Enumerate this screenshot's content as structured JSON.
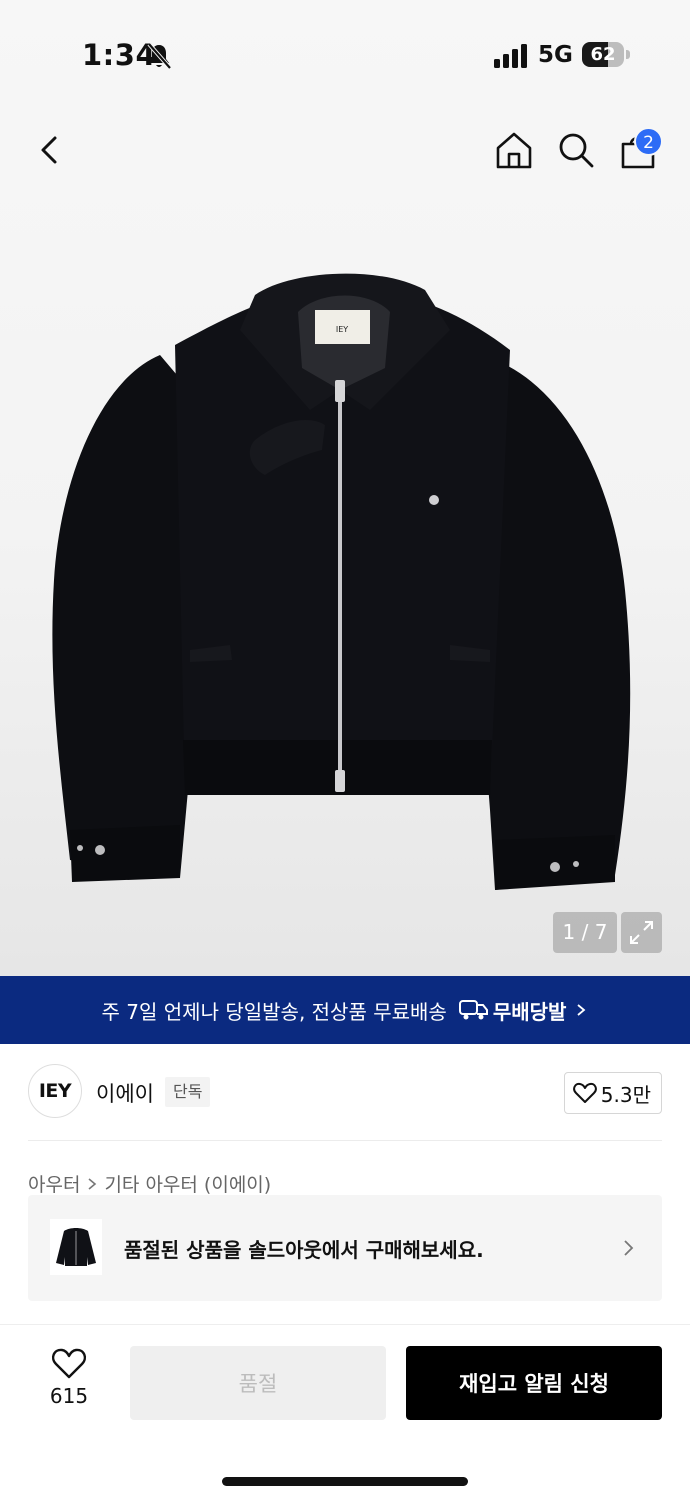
{
  "status_bar": {
    "time": "1:34",
    "network": "5G",
    "battery": "62",
    "icons": [
      "bell-off-icon",
      "signal-icon",
      "battery-icon"
    ]
  },
  "nav": {
    "icons": [
      "back-icon",
      "home-icon",
      "search-icon",
      "bag-icon"
    ],
    "cart_count": "2"
  },
  "gallery": {
    "pager": "1 / 7",
    "label_on_garment": "IEY",
    "expand_icon": "expand-icon"
  },
  "banner": {
    "text": "주 7일 언제나 당일발송, 전상품 무료배송",
    "logo_text": "무배당발",
    "background": "#0b2a80"
  },
  "brand": {
    "logo_text": "IEY",
    "name": "이에이",
    "badge": "단독",
    "likes": "5.3만"
  },
  "breadcrumb": {
    "items": [
      "아우터",
      "기타 아우터 (이에이)"
    ]
  },
  "soldout_card": {
    "text": "품절된 상품을 솔드아웃에서 구매해보세요."
  },
  "bottom_bar": {
    "wish_count": "615",
    "soldout_label": "품절",
    "restock_label": "재입고 알림 신청"
  },
  "colors": {
    "accent_badge": "#2d6cf6",
    "primary_button": "#000000",
    "disabled_button": "#efefef"
  }
}
